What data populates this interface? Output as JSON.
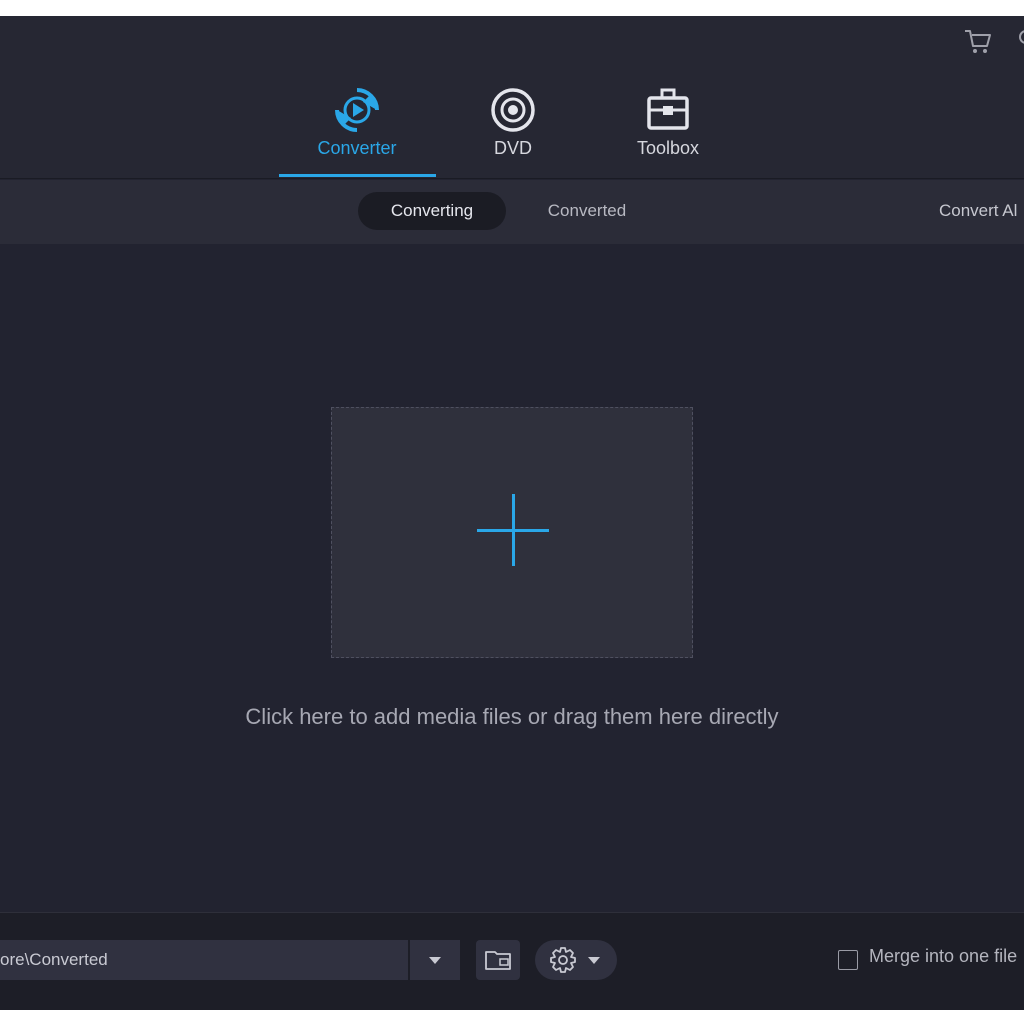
{
  "header": {
    "nav": [
      {
        "label": "Converter",
        "icon": "converter-icon",
        "active": true
      },
      {
        "label": "DVD",
        "icon": "disc-icon",
        "active": false
      },
      {
        "label": "Toolbox",
        "icon": "toolbox-icon",
        "active": false
      }
    ],
    "cart_icon": "cart-icon"
  },
  "subtabs": {
    "items": [
      {
        "label": "Converting",
        "active": true
      },
      {
        "label": "Converted",
        "active": false
      }
    ],
    "convert_all_label": "Convert Al"
  },
  "main": {
    "add_icon": "plus-icon",
    "hint": "Click here to add media files or drag them here directly"
  },
  "footer": {
    "output_path": "ore\\Converted",
    "merge_label": "Merge into one file",
    "merge_checked": false
  },
  "colors": {
    "accent": "#2aa7e8",
    "background": "#222330",
    "panel": "#2f303c"
  }
}
